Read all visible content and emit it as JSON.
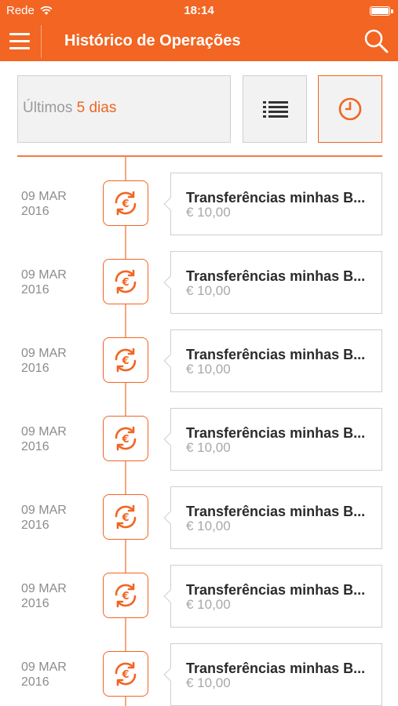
{
  "status_bar": {
    "carrier": "Rede",
    "time": "18:14",
    "battery_level": 0.95
  },
  "header": {
    "title": "Histórico de Operações"
  },
  "filter": {
    "label_prefix": "Últimos",
    "label_value": "5 dias"
  },
  "colors": {
    "accent": "#f26522",
    "text_muted": "#8c8c8c",
    "border": "#cfcfcf"
  },
  "icons": {
    "menu": "hamburger-icon",
    "search": "search-icon",
    "list": "list-icon",
    "clock": "clock-icon",
    "transfer": "euro-transfer-icon"
  },
  "operations": [
    {
      "day": "09 MAR",
      "year": "2016",
      "title": "Transferências minhas B...",
      "amount": "€ 10,00"
    },
    {
      "day": "09 MAR",
      "year": "2016",
      "title": "Transferências minhas B...",
      "amount": "€ 10,00"
    },
    {
      "day": "09 MAR",
      "year": "2016",
      "title": "Transferências minhas B...",
      "amount": "€ 10,00"
    },
    {
      "day": "09 MAR",
      "year": "2016",
      "title": "Transferências minhas B...",
      "amount": "€ 10,00"
    },
    {
      "day": "09 MAR",
      "year": "2016",
      "title": "Transferências minhas B...",
      "amount": "€ 10,00"
    },
    {
      "day": "09 MAR",
      "year": "2016",
      "title": "Transferências minhas B...",
      "amount": "€ 10,00"
    },
    {
      "day": "09 MAR",
      "year": "2016",
      "title": "Transferências minhas B...",
      "amount": "€ 10,00"
    }
  ]
}
